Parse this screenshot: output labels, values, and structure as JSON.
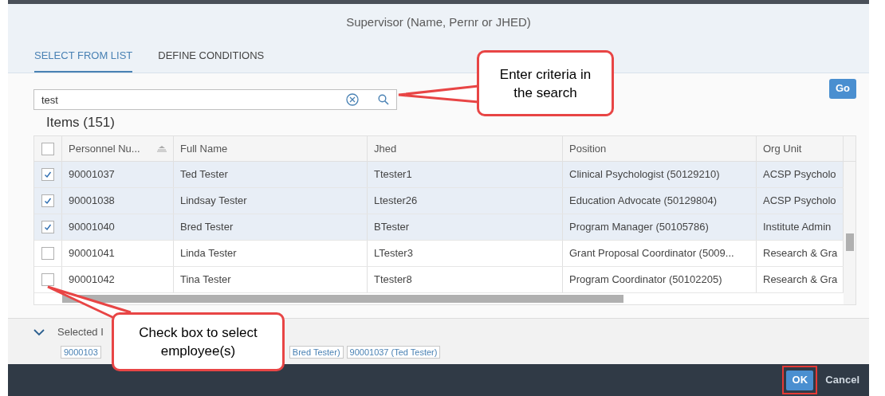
{
  "dialog": {
    "title": "Supervisor (Name, Pernr or JHED)"
  },
  "tabs": [
    {
      "label": "SELECT FROM LIST",
      "selected": true
    },
    {
      "label": "DEFINE CONDITIONS",
      "selected": false
    }
  ],
  "search": {
    "value": "test"
  },
  "go_button": "Go",
  "items_count": "Items (151)",
  "table": {
    "select_all_checked": false,
    "columns": [
      "Personnel Nu...",
      "Full Name",
      "Jhed",
      "Position",
      "Org Unit"
    ],
    "rows": [
      {
        "checked": true,
        "cells": [
          "90001037",
          "Ted Tester",
          "Ttester1",
          "Clinical Psychologist (50129210)",
          "ACSP Psycholo"
        ]
      },
      {
        "checked": true,
        "cells": [
          "90001038",
          "Lindsay Tester",
          "Ltester26",
          "Education Advocate (50129804)",
          "ACSP Psycholo"
        ]
      },
      {
        "checked": true,
        "cells": [
          "90001040",
          "Bred Tester",
          "BTester",
          "Program Manager (50105786)",
          "Institute Admin"
        ]
      },
      {
        "checked": false,
        "cells": [
          "90001041",
          "Linda Tester",
          "LTester3",
          "Grant Proposal Coordinator (5009...",
          "Research & Gra"
        ]
      },
      {
        "checked": false,
        "cells": [
          "90001042",
          "Tina Tester",
          "Ttester8",
          "Program Coordinator (50102205)",
          "Research & Gra"
        ]
      }
    ]
  },
  "selected_section": {
    "label": "Selected I",
    "expanded": true,
    "tokens": [
      "9000103",
      "Bred Tester)",
      "90001037 (Ted Tester)"
    ]
  },
  "footer": {
    "ok": "OK",
    "cancel": "Cancel"
  },
  "callouts": [
    {
      "text": "Enter criteria in the search"
    },
    {
      "text": "Check box to select employee(s)"
    }
  ]
}
